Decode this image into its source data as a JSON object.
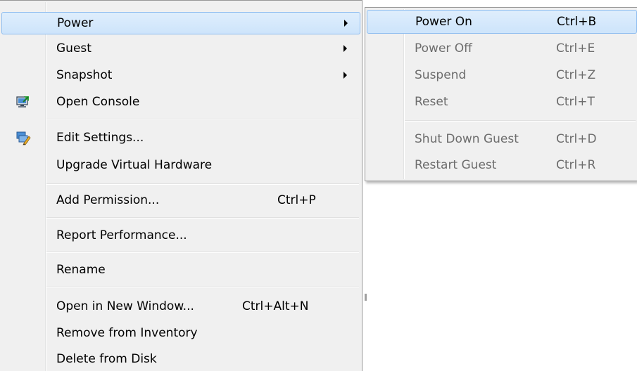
{
  "main_menu": {
    "items": [
      {
        "label": "Power",
        "has_submenu": true,
        "highlighted": true
      },
      {
        "label": "Guest",
        "has_submenu": true
      },
      {
        "label": "Snapshot",
        "has_submenu": true
      },
      {
        "label": "Open Console",
        "icon": "console-icon"
      },
      {
        "label": "Edit Settings...",
        "icon": "edit-settings-icon"
      },
      {
        "label": "Upgrade Virtual Hardware"
      },
      {
        "label": "Add Permission...",
        "shortcut": "Ctrl+P"
      },
      {
        "label": "Report Performance..."
      },
      {
        "label": "Rename"
      },
      {
        "label": "Open in New Window...",
        "shortcut": "Ctrl+Alt+N"
      },
      {
        "label": "Remove from Inventory"
      },
      {
        "label": "Delete from Disk"
      }
    ]
  },
  "power_submenu": {
    "items": [
      {
        "label": "Power On",
        "shortcut": "Ctrl+B",
        "enabled": true,
        "highlighted": true
      },
      {
        "label": "Power Off",
        "shortcut": "Ctrl+E",
        "enabled": false
      },
      {
        "label": "Suspend",
        "shortcut": "Ctrl+Z",
        "enabled": false
      },
      {
        "label": "Reset",
        "shortcut": "Ctrl+T",
        "enabled": false
      },
      {
        "label": "Shut Down Guest",
        "shortcut": "Ctrl+D",
        "enabled": false
      },
      {
        "label": "Restart Guest",
        "shortcut": "Ctrl+R",
        "enabled": false
      }
    ]
  },
  "colors": {
    "menu_background": "#f0f0f0",
    "highlight_fill": "#cde4fb",
    "highlight_border": "#8ebdf0",
    "disabled_text": "#6d6d6d"
  }
}
